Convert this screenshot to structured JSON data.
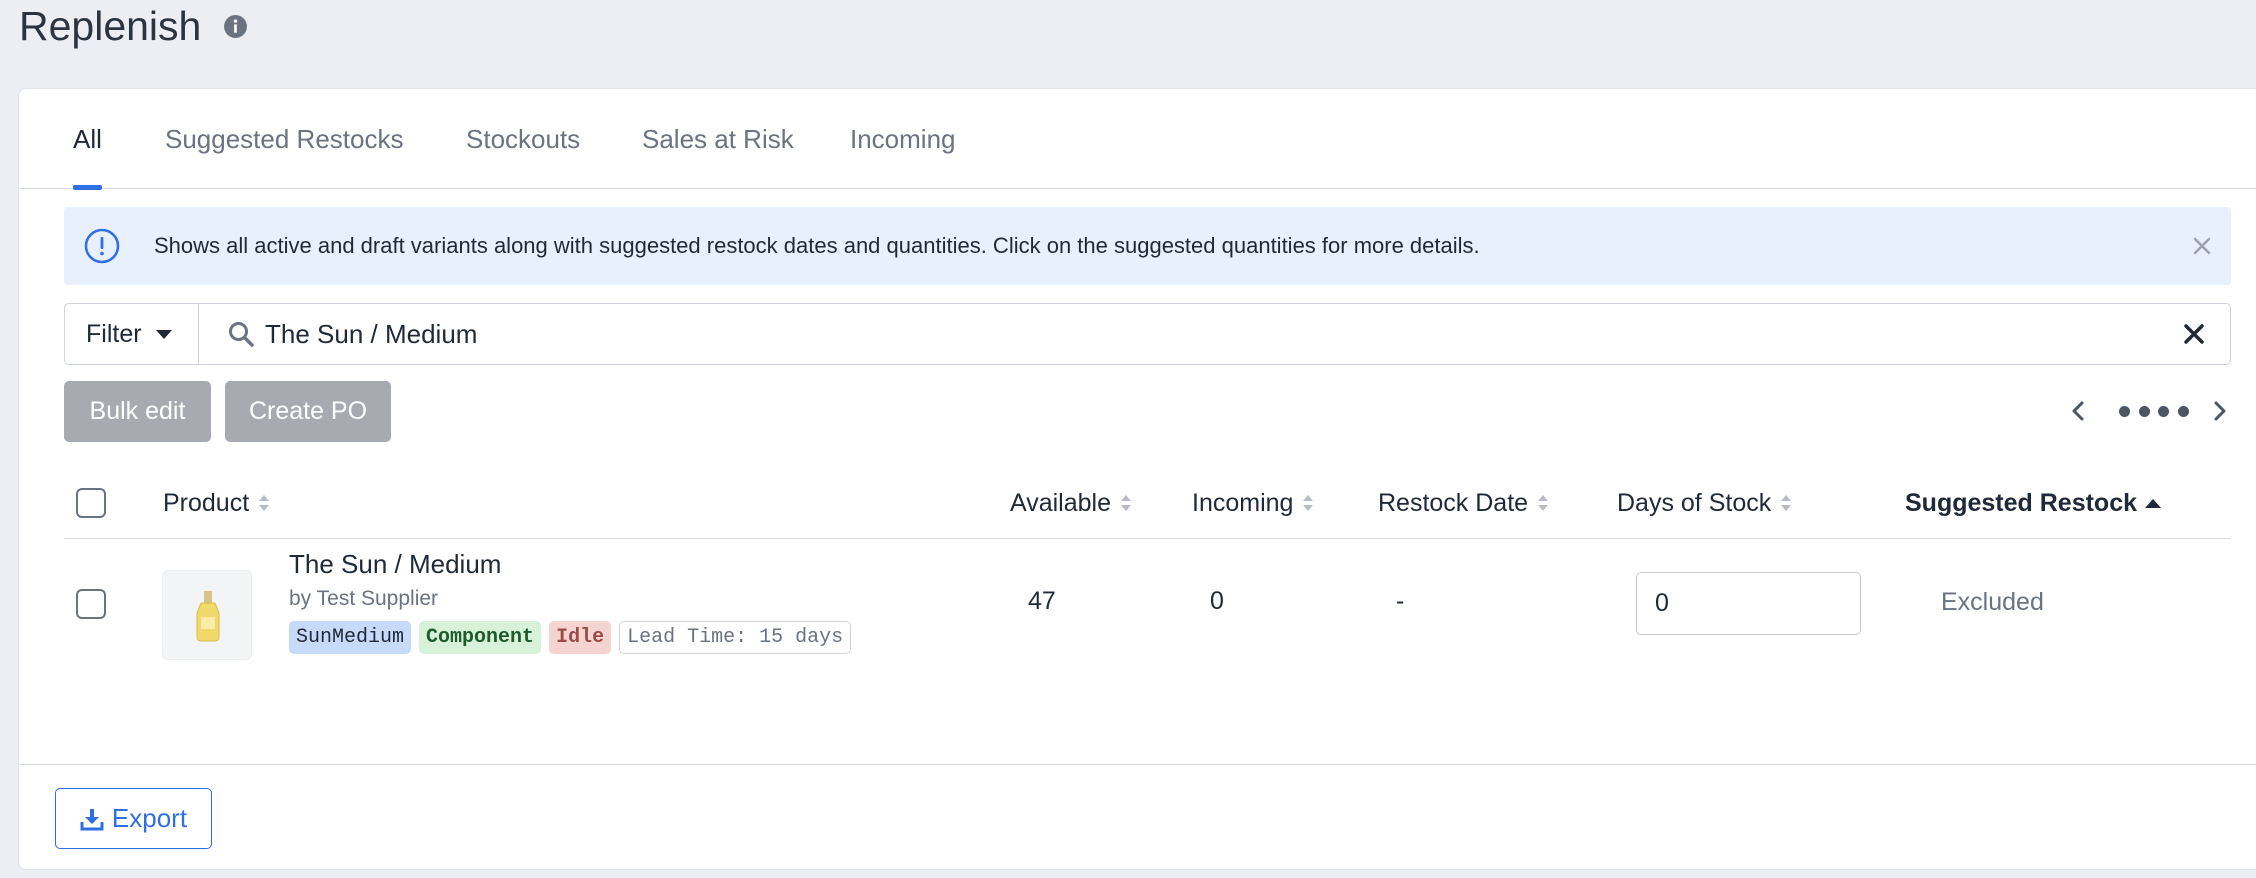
{
  "page": {
    "title": "Replenish"
  },
  "tabs": [
    {
      "label": "All",
      "active": true
    },
    {
      "label": "Suggested Restocks",
      "active": false
    },
    {
      "label": "Stockouts",
      "active": false
    },
    {
      "label": "Sales at Risk",
      "active": false
    },
    {
      "label": "Incoming",
      "active": false
    }
  ],
  "alert": {
    "text": "Shows all active and draft variants along with suggested restock dates and quantities. Click on the suggested quantities for more details."
  },
  "search": {
    "filter_label": "Filter",
    "value": "The Sun / Medium"
  },
  "actions": {
    "bulk_edit": "Bulk edit",
    "create_po": "Create PO"
  },
  "table": {
    "columns": {
      "product": "Product",
      "available": "Available",
      "incoming": "Incoming",
      "restock_date": "Restock Date",
      "days_of_stock": "Days of Stock",
      "suggested_restock": "Suggested Restock"
    },
    "rows": [
      {
        "name": "The Sun / Medium",
        "supplier": "by Test Supplier",
        "tags": {
          "sku": "SunMedium",
          "component": "Component",
          "idle": "Idle",
          "lead_time": "Lead Time: 15 days"
        },
        "available": "47",
        "incoming": "0",
        "restock_date": "-",
        "days_of_stock": "0",
        "suggested_restock": "Excluded"
      }
    ]
  },
  "footer": {
    "export": "Export"
  },
  "colors": {
    "accent": "#2f6fe4",
    "alert_bg": "#e8effd",
    "disabled_button": "#a7abb1"
  }
}
